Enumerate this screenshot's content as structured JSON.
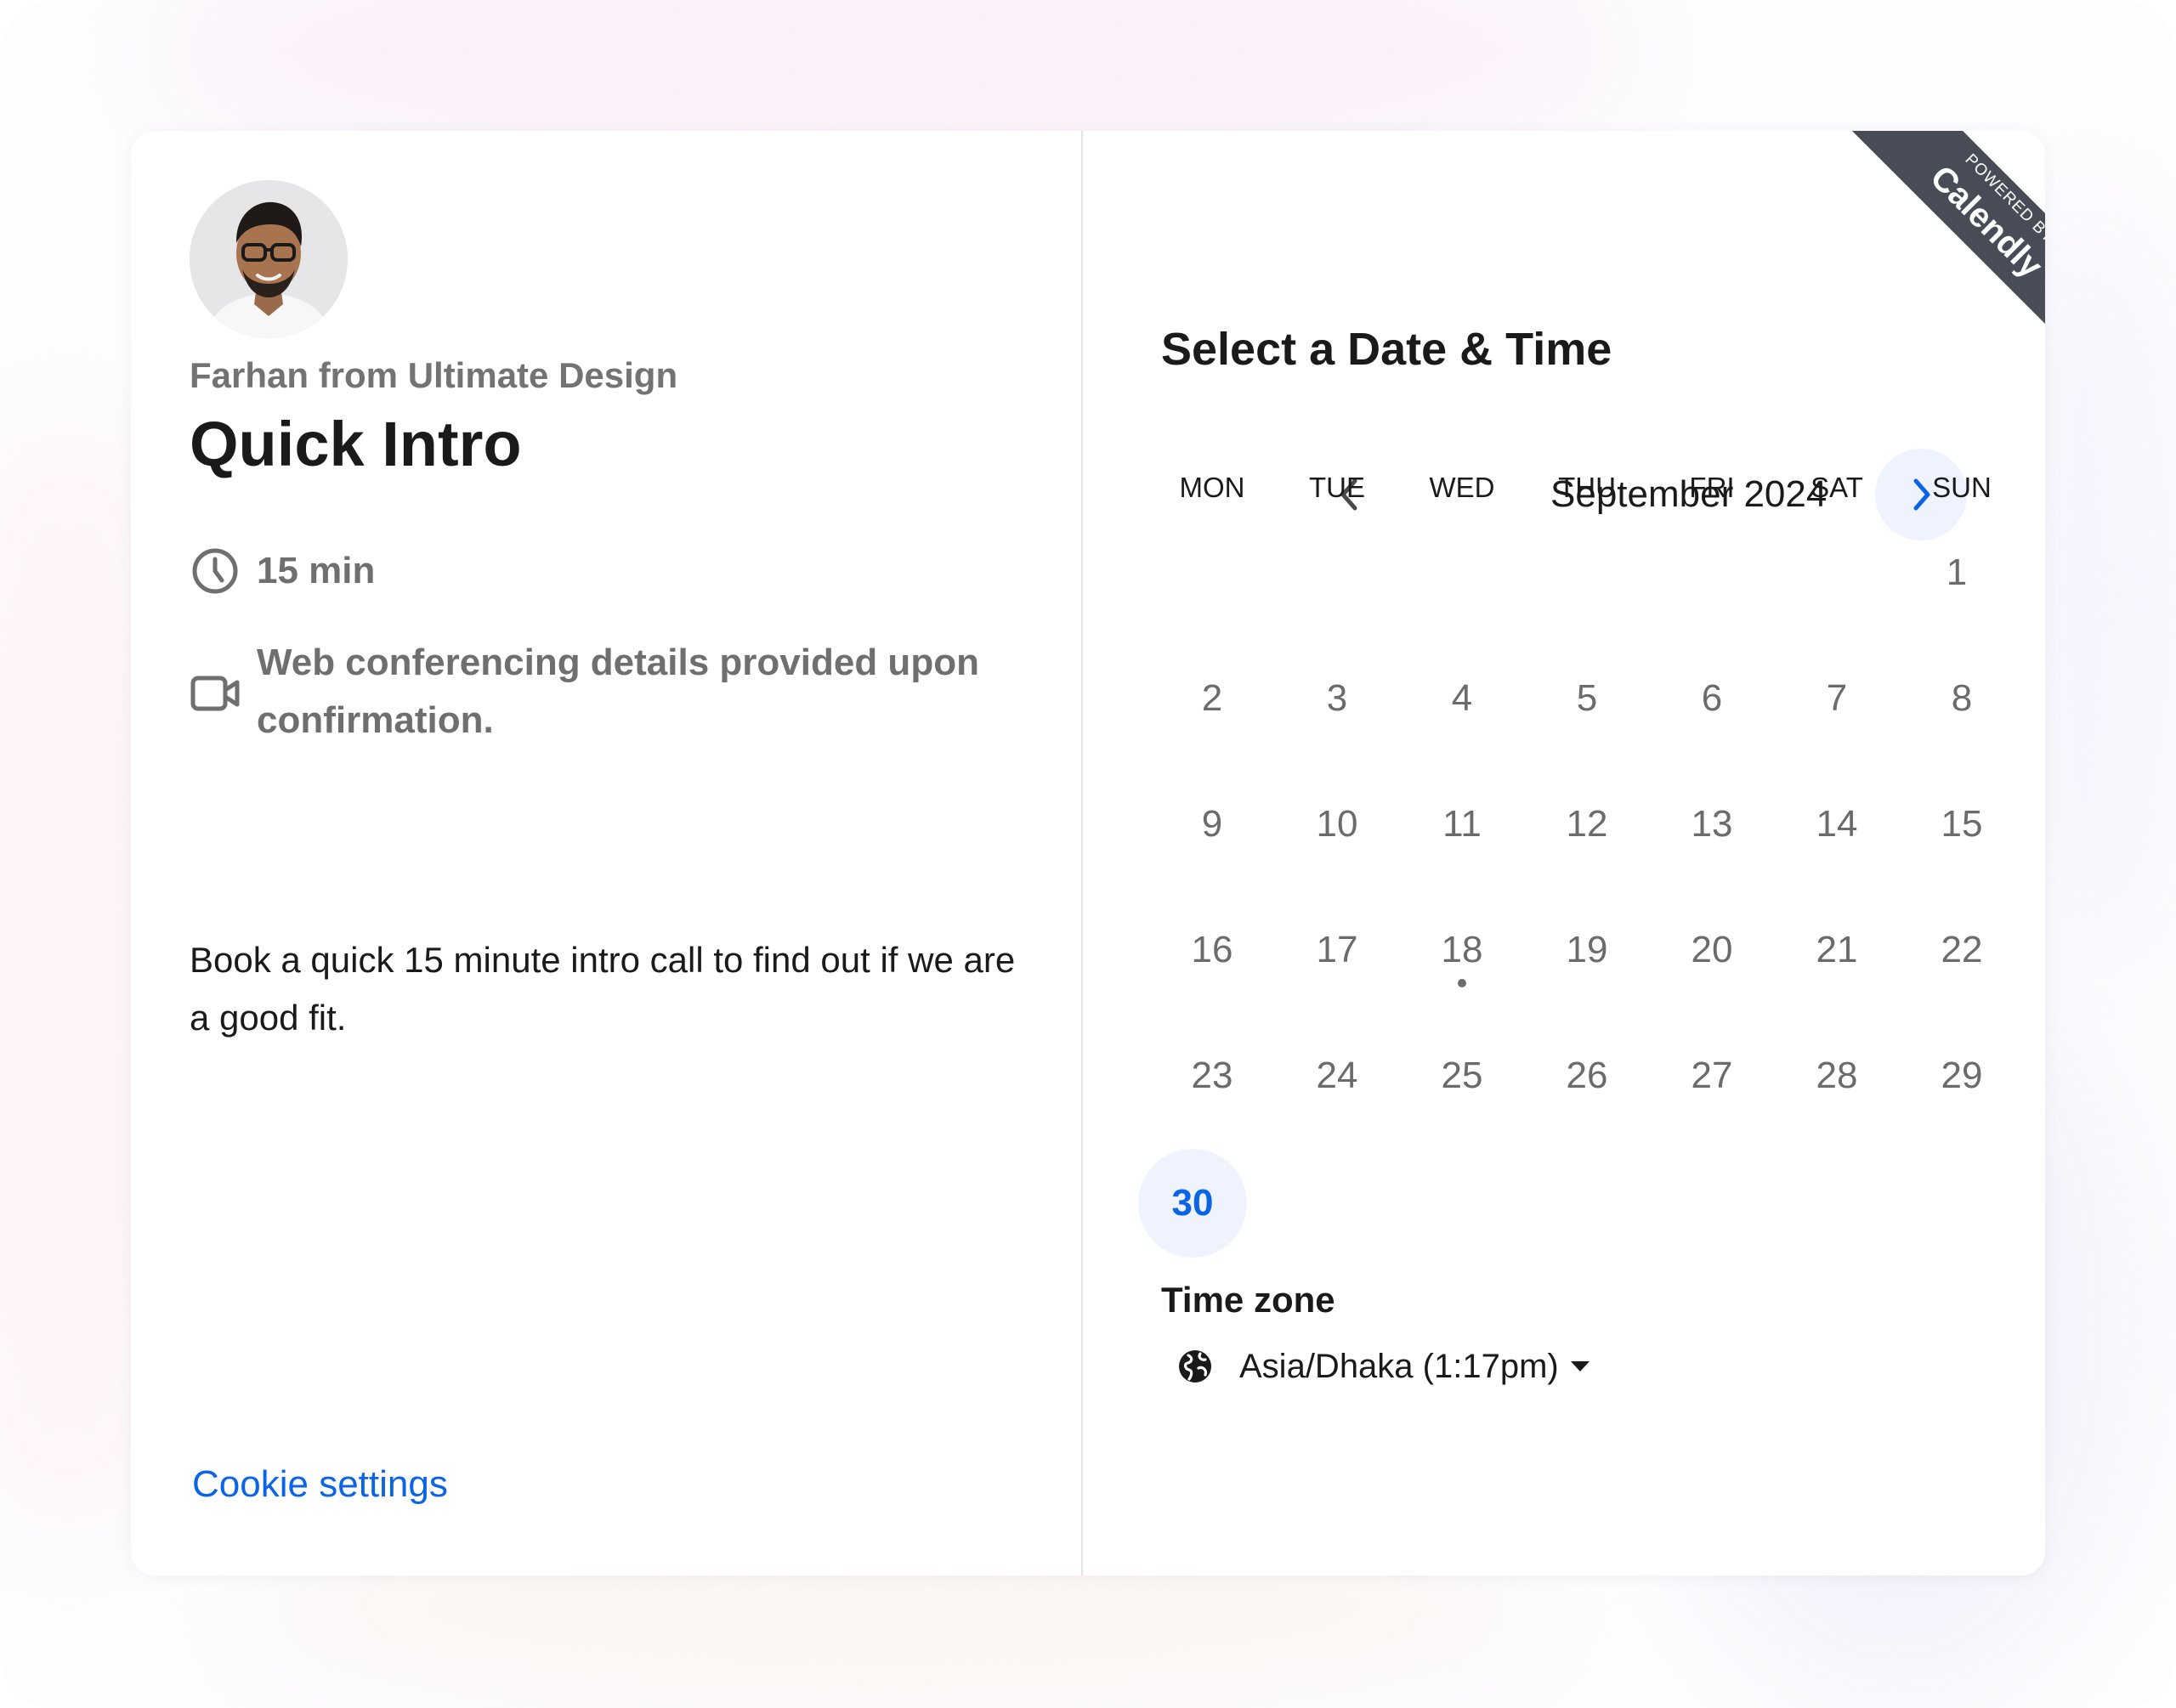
{
  "event": {
    "host": "Farhan from Ultimate Design",
    "title": "Quick Intro",
    "duration": "15 min",
    "conferencing": "Web conferencing details provided upon confirmation.",
    "description": "Book a quick 15 minute intro call to find out if we are a good fit.",
    "avatar_icon": "profile-photo"
  },
  "footer": {
    "cookie_settings": "Cookie settings"
  },
  "scheduler": {
    "title": "Select a Date & Time",
    "month": "September 2024",
    "weekdays": [
      "MON",
      "TUE",
      "WED",
      "THU",
      "FRI",
      "SAT",
      "SUN"
    ],
    "days": [
      "1",
      "2",
      "3",
      "4",
      "5",
      "6",
      "7",
      "8",
      "9",
      "10",
      "11",
      "12",
      "13",
      "14",
      "15",
      "16",
      "17",
      "18",
      "19",
      "20",
      "21",
      "22",
      "23",
      "24",
      "25",
      "26",
      "27",
      "28",
      "29",
      "30"
    ],
    "today": "18",
    "available_day": "30"
  },
  "timezone": {
    "label": "Time zone",
    "value": "Asia/Dhaka (1:17pm)"
  },
  "badge": {
    "powered_by": "POWERED BY",
    "brand": "Calendly"
  },
  "colors": {
    "accent": "#0b63e5",
    "accent_soft": "#eef3fd",
    "badge_bg": "#474c57",
    "text_primary": "#1a1a1a",
    "text_muted": "#6f6f6f"
  }
}
